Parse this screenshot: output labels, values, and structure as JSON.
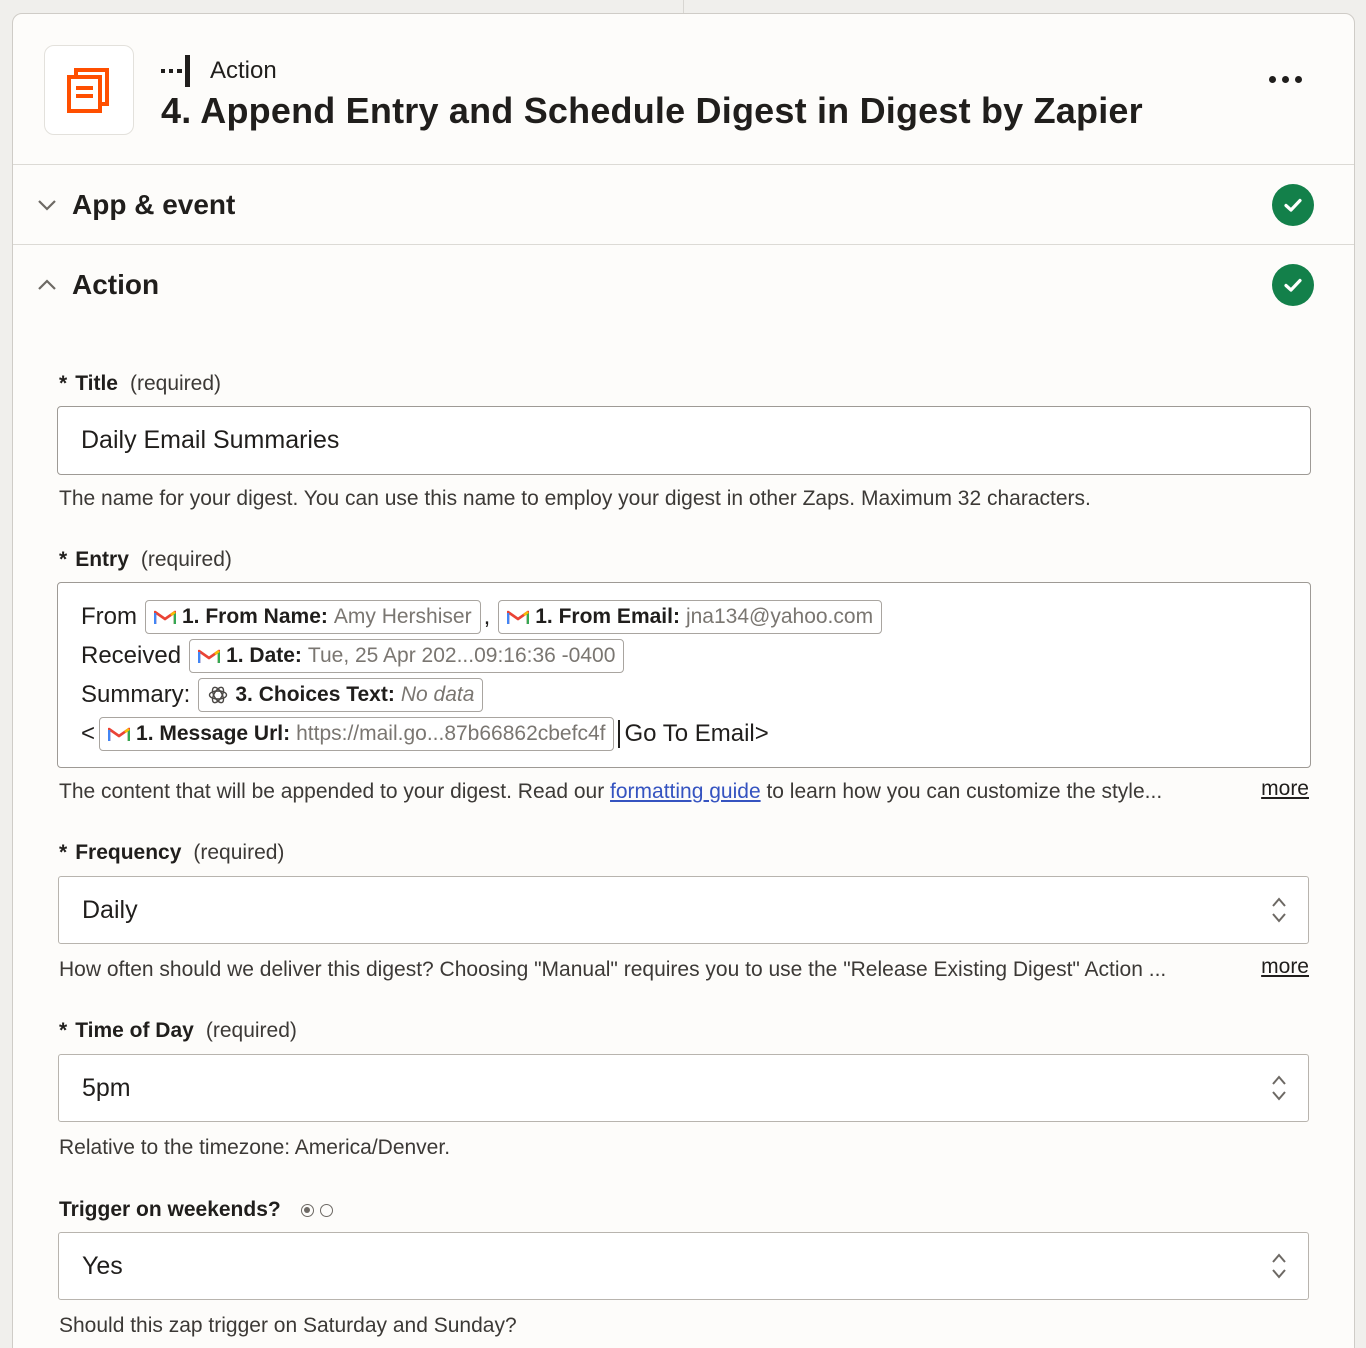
{
  "step": {
    "kind_label": "Action",
    "title": "4. Append Entry and Schedule Digest in Digest by Zapier",
    "app_logo_icon": "digest-by-zapier-logo",
    "brand_color": "#ff4f00"
  },
  "sections": {
    "app_event": {
      "label": "App & event",
      "status": "complete"
    },
    "action": {
      "label": "Action",
      "status": "complete"
    }
  },
  "fields": {
    "title": {
      "star": "*",
      "label": "Title",
      "required_text": "(required)",
      "value": "Daily Email Summaries",
      "help": "The name for your digest. You can use this name to employ your digest in other Zaps. Maximum 32 characters."
    },
    "entry": {
      "star": "*",
      "label": "Entry",
      "required_text": "(required)",
      "line1_text": "From",
      "pill_from_name": {
        "key": "1. From Name:",
        "value": "Amy Hershiser",
        "icon": "gmail-icon"
      },
      "comma": ",",
      "pill_from_email": {
        "key": "1. From Email:",
        "value": "jna134@yahoo.com",
        "icon": "gmail-icon"
      },
      "line2_text": "Received",
      "pill_date": {
        "key": "1. Date:",
        "value": "Tue, 25 Apr 202...09:16:36 -0400",
        "icon": "gmail-icon"
      },
      "line3_text": "Summary:",
      "pill_choices": {
        "key": "3. Choices Text:",
        "value": "No data",
        "icon": "openai-icon"
      },
      "line4_prefix": "<",
      "pill_message_url": {
        "key": "1. Message Url:",
        "value": "https://mail.go...87b66862cbefc4f",
        "icon": "gmail-icon"
      },
      "line4_suffix": "Go To Email>",
      "help_before": "The content that will be appended to your digest. Read our ",
      "help_link": "formatting guide",
      "help_after": " to learn how you can customize the style...",
      "more": "more"
    },
    "frequency": {
      "star": "*",
      "label": "Frequency",
      "required_text": "(required)",
      "value": "Daily",
      "help": "How often should we deliver this digest? Choosing \"Manual\" requires you to use the \"Release Existing Digest\" Action ...",
      "more": "more"
    },
    "time_of_day": {
      "star": "*",
      "label": "Time of Day",
      "required_text": "(required)",
      "value": "5pm",
      "help": "Relative to the timezone: America/Denver."
    },
    "weekends": {
      "label": "Trigger on weekends?",
      "radio_selected_index": 0,
      "value": "Yes",
      "help": "Should this zap trigger on Saturday and Sunday?"
    }
  },
  "colors": {
    "success": "#13804a",
    "link": "#3553c0",
    "text": "#201e1c"
  }
}
